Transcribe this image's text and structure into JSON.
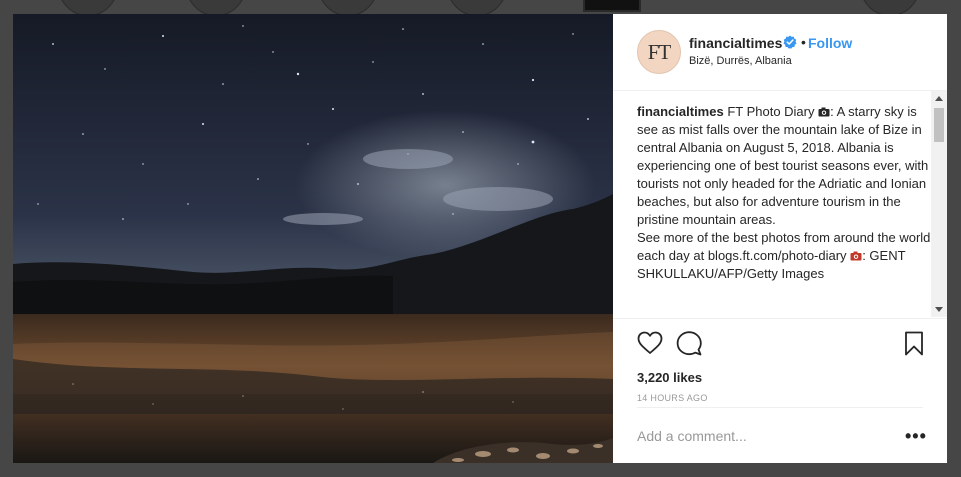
{
  "post": {
    "username": "financialtimes",
    "avatar_text": "FT",
    "follow_label": "Follow",
    "separator": "•",
    "location": "Bizë, Durrës, Albania",
    "caption": {
      "author": "financialtimes",
      "line1": " FT Photo Diary ",
      "line2": ": A starry sky is see as mist falls over the mountain lake of Bize in central Albania on August 5, 2018. Albania is experiencing one of best tourist seasons ever, with tourists not only headed for the Adriatic and Ionian beaches, but also for adventure tourism in the pristine mountain areas.",
      "line3": "See more of the best photos from around the world each day at blogs.ft.com/photo-diary ",
      "credit": ": GENT SHKULLAKU/AFP/Getty Images"
    },
    "likes": "3,220 likes",
    "time": "14 HOURS AGO",
    "comment_placeholder": "Add a comment...",
    "more_label": "•••"
  },
  "icons": {
    "verified": "verified-badge-icon",
    "like": "heart-icon",
    "comment": "comment-icon",
    "save": "bookmark-icon",
    "camera": "camera-icon"
  },
  "colors": {
    "accent": "#3897f0",
    "text": "#262626",
    "muted": "#999999",
    "camera_red": "#c0392b"
  }
}
